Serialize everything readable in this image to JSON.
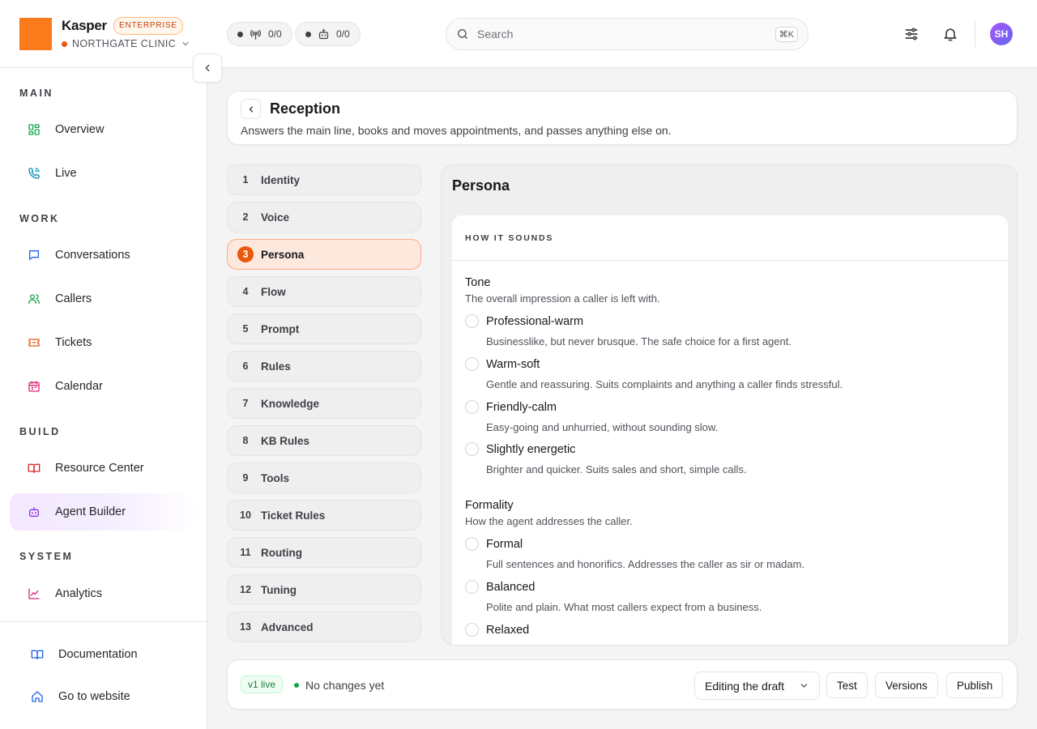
{
  "app": {
    "name": "Kasper",
    "plan": "ENTERPRISE",
    "org": "NORTHGATE CLINIC"
  },
  "topbar": {
    "calls_counter": "0/0",
    "agents_counter": "0/0",
    "search_placeholder": "Search",
    "search_shortcut": "⌘K",
    "avatar_initials": "SH"
  },
  "sidebar": {
    "sections": {
      "main": "MAIN",
      "work": "WORK",
      "build": "BUILD",
      "system": "SYSTEM"
    },
    "items": {
      "overview": "Overview",
      "live": "Live",
      "conversations": "Conversations",
      "callers": "Callers",
      "tickets": "Tickets",
      "calendar": "Calendar",
      "resource_center": "Resource Center",
      "agent_builder": "Agent Builder",
      "analytics": "Analytics"
    },
    "bottom": {
      "documentation": "Documentation",
      "website": "Go to website"
    },
    "active": "agent_builder"
  },
  "agent": {
    "name": "Reception",
    "description": "Answers the main line, books and moves appointments, and passes anything else on."
  },
  "steps": [
    {
      "num": "1",
      "label": "Identity"
    },
    {
      "num": "2",
      "label": "Voice"
    },
    {
      "num": "3",
      "label": "Persona"
    },
    {
      "num": "4",
      "label": "Flow"
    },
    {
      "num": "5",
      "label": "Prompt"
    },
    {
      "num": "6",
      "label": "Rules"
    },
    {
      "num": "7",
      "label": "Knowledge"
    },
    {
      "num": "8",
      "label": "KB Rules"
    },
    {
      "num": "9",
      "label": "Tools"
    },
    {
      "num": "10",
      "label": "Ticket Rules"
    },
    {
      "num": "11",
      "label": "Routing"
    },
    {
      "num": "12",
      "label": "Tuning"
    },
    {
      "num": "13",
      "label": "Advanced"
    }
  ],
  "active_step": 3,
  "persona": {
    "title": "Persona",
    "section_label": "HOW IT SOUNDS",
    "tone": {
      "title": "Tone",
      "description": "The overall impression a caller is left with.",
      "options": [
        {
          "label": "Professional-warm",
          "description": "Businesslike, but never brusque. The safe choice for a first agent."
        },
        {
          "label": "Warm-soft",
          "description": "Gentle and reassuring. Suits complaints and anything a caller finds stressful."
        },
        {
          "label": "Friendly-calm",
          "description": "Easy-going and unhurried, without sounding slow."
        },
        {
          "label": "Slightly energetic",
          "description": "Brighter and quicker. Suits sales and short, simple calls."
        }
      ]
    },
    "formality": {
      "title": "Formality",
      "description": "How the agent addresses the caller.",
      "options": [
        {
          "label": "Formal",
          "description": "Full sentences and honorifics. Addresses the caller as sir or madam."
        },
        {
          "label": "Balanced",
          "description": "Polite and plain. What most callers expect from a business."
        },
        {
          "label": "Relaxed",
          "description": ""
        }
      ]
    }
  },
  "footer": {
    "version_badge": "v1 live",
    "status": "No changes yet",
    "mode": "Editing the draft",
    "test": "Test",
    "versions": "Versions",
    "publish": "Publish"
  },
  "colors": {
    "brand": "#fb7a1c",
    "accent": "#ea580c",
    "live": "#16a34a",
    "active_nav": "#f3e8ff"
  }
}
